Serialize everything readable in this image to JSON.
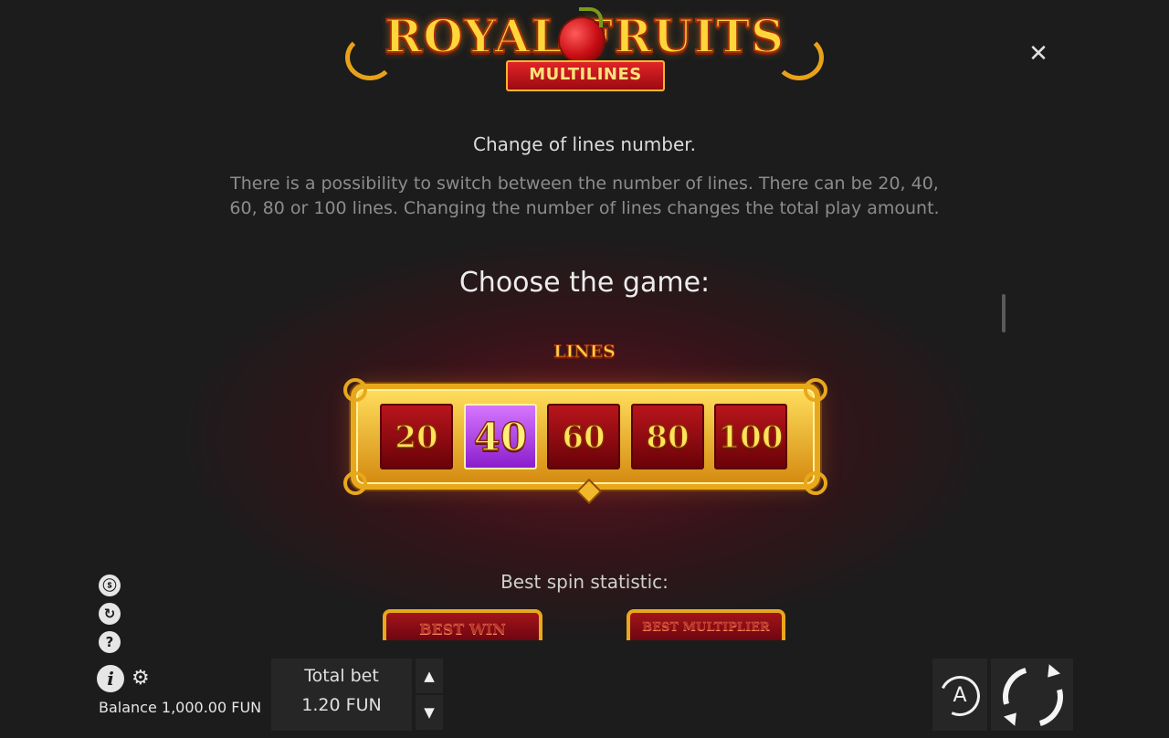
{
  "logo": {
    "title": "ROYAL FRUITS",
    "subtitle": "MULTILINES"
  },
  "rules": {
    "lines_title": "Change of lines number.",
    "lines_text": "There is a possibility to switch between the number of lines. There can be 20, 40, 60, 80 or 100 lines. Changing the number of lines changes the total play amount.",
    "choose_title": "Choose the game:"
  },
  "lines_selector": {
    "label": "LINES",
    "options": [
      "20",
      "40",
      "60",
      "80",
      "100"
    ],
    "selected": "40"
  },
  "stats": {
    "title": "Best spin statistic:",
    "best_win_label": "BEST WIN",
    "best_multiplier_label": "BEST MULTIPLIER"
  },
  "footer": {
    "balance": "Balance 1,000.00 FUN",
    "total_bet_label": "Total bet",
    "total_bet_value": "1.20 FUN",
    "auto_label": "A"
  },
  "icons": {
    "close": "close-icon",
    "info": "info-icon",
    "settings": "gear-icon",
    "help": "question-icon",
    "turbo": "turbo-icon",
    "history": "history-icon",
    "spin": "spin-icon"
  }
}
